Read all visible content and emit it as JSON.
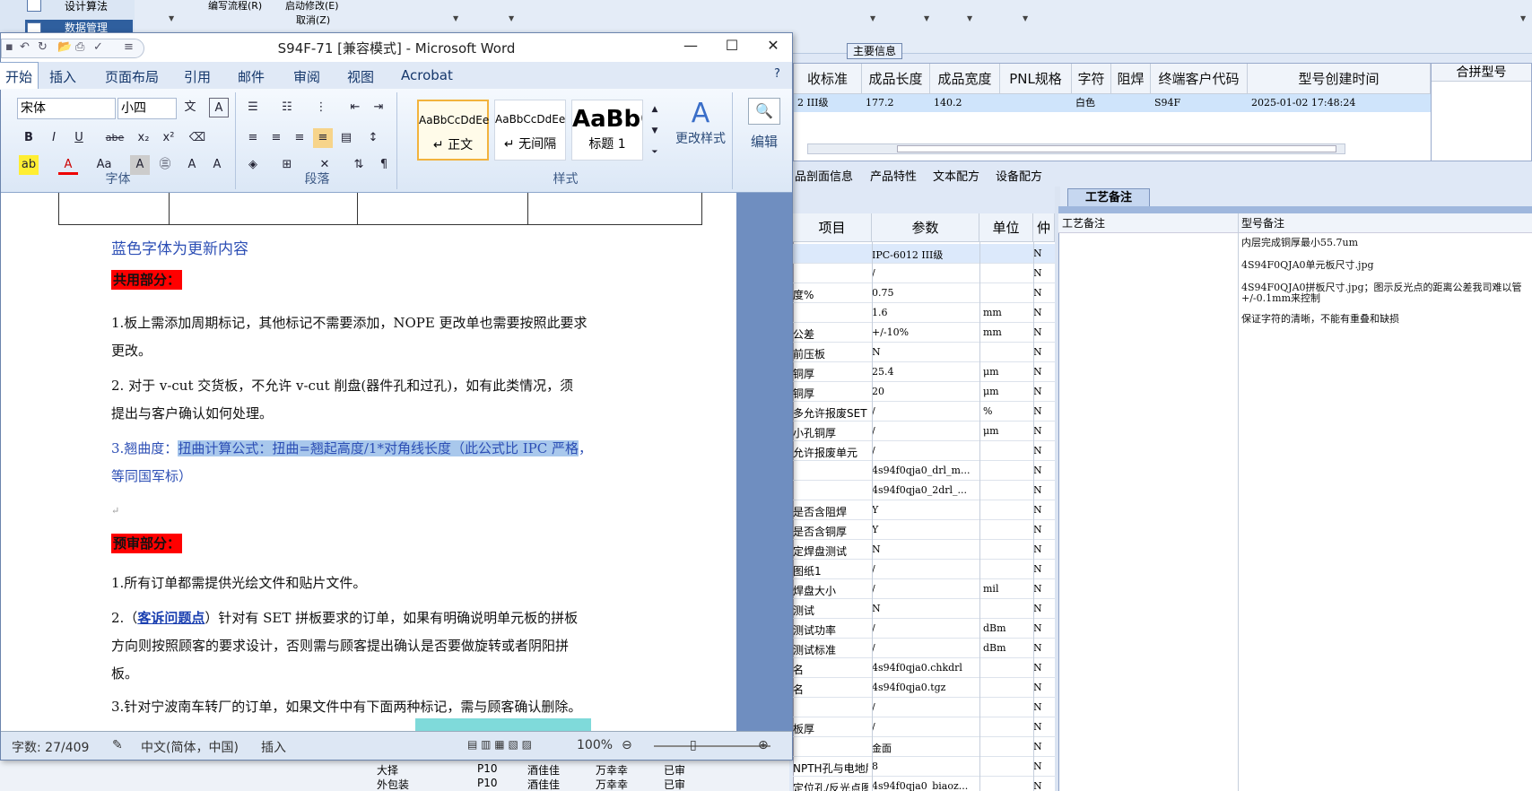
{
  "bg": {
    "left_menu": [
      "设计算法",
      "数据管理"
    ],
    "toolbar_items": [
      "编写流程(R)",
      "启动修改(E)",
      "取消(Z)"
    ],
    "info_tab": "主要信息",
    "grid_headers": [
      "收标准",
      "成品长度",
      "成品宽度",
      "PNL规格",
      "字符",
      "阻焊",
      "终端客户代码",
      "型号创建时间"
    ],
    "grid_row": [
      "2 III级",
      "177.2",
      "140.2",
      "",
      "白色",
      "",
      "S94F",
      "2025-01-02 17:48:24"
    ],
    "merge_header": "合拼型号",
    "sub_tabs": [
      "品剖面信息",
      "产品特性",
      "文本配方",
      "设备配方"
    ],
    "param_headers": [
      "项目",
      "参数",
      "单位",
      "仲"
    ],
    "param_rows": [
      [
        "",
        "IPC-6012 III级",
        "",
        "N"
      ],
      [
        "",
        "/",
        "",
        "N"
      ],
      [
        "度%",
        "0.75",
        "",
        "N"
      ],
      [
        "",
        "1.6",
        "mm",
        "N"
      ],
      [
        "公差",
        "+/-10%",
        "mm",
        "N"
      ],
      [
        "前压板",
        "N",
        "",
        "N"
      ],
      [
        "铜厚",
        "25.4",
        "μm",
        "N"
      ],
      [
        "铜厚",
        "20",
        "μm",
        "N"
      ],
      [
        "多允许报废SET",
        "/",
        "%",
        "N"
      ],
      [
        "小孔铜厚",
        "/",
        "μm",
        "N"
      ],
      [
        "允许报废单元",
        "/",
        "",
        "N"
      ],
      [
        "",
        "4s94f0qja0_drl_m...",
        "",
        "N"
      ],
      [
        "",
        "4s94f0qja0_2drl_...",
        "",
        "N"
      ],
      [
        "是否含阻焊",
        "Y",
        "",
        "N"
      ],
      [
        "是否含铜厚",
        "Y",
        "",
        "N"
      ],
      [
        "定焊盘测试",
        "N",
        "",
        "N"
      ],
      [
        "图纸1",
        "/",
        "",
        "N"
      ],
      [
        "焊盘大小",
        "/",
        "mil",
        "N"
      ],
      [
        "测试",
        "N",
        "",
        "N"
      ],
      [
        "测试功率",
        "/",
        "dBm",
        "N"
      ],
      [
        "测试标准",
        "/",
        "dBm",
        "N"
      ],
      [
        "名",
        "4s94f0qja0.chkdrl",
        "",
        "N"
      ],
      [
        "名",
        "4s94f0qja0.tgz",
        "",
        "N"
      ],
      [
        "",
        "/",
        "",
        "N"
      ],
      [
        "板厚",
        "/",
        "",
        "N"
      ],
      [
        "",
        "金面",
        "",
        "N"
      ],
      [
        "NPTH孔与电地层空距",
        "8",
        "",
        "N"
      ],
      [
        "定位孔/反光点图纸",
        "4s94f0qja0_biaoz...",
        "",
        "N"
      ]
    ],
    "remarks_tab": "工艺备注",
    "remarks_headers": [
      "工艺备注",
      "型号备注"
    ],
    "remarks_lines": [
      "内层完成铜厚最小55.7um",
      "4S94F0QJA0单元板尺寸.jpg",
      "4S94F0QJA0拼板尺寸.jpg；图示反光点的距离公差我司难以管",
      "+/-0.1mm来控制",
      "保证字符的清晰，不能有重叠和缺损"
    ],
    "bottom_list": [
      [
        "大择",
        "P10",
        "酒佳佳",
        "万幸幸",
        "已审"
      ],
      [
        "外包装",
        "P10",
        "酒佳佳",
        "万幸幸",
        "已审"
      ]
    ]
  },
  "word": {
    "title": "S94F-71 [兼容模式] - Microsoft Word",
    "tabs": [
      "开始",
      "插入",
      "页面布局",
      "引用",
      "邮件",
      "审阅",
      "视图",
      "Acrobat"
    ],
    "font_name": "宋体",
    "font_size": "小四",
    "groups": [
      "字体",
      "段落",
      "样式"
    ],
    "styles": [
      {
        "sample": "AaBbCcDdEe",
        "name": "↵ 正文"
      },
      {
        "sample": "AaBbCcDdEe",
        "name": "↵ 无间隔"
      },
      {
        "sample": "AaBbC",
        "name": "标题 1"
      }
    ],
    "change_styles": "更改样式",
    "edit": "编辑",
    "doc": {
      "heading": "蓝色字体为更新内容",
      "common": "共用部分：",
      "p1a": "1.板上需添加周期标记，其他标记不需要添加，NOPE 更改单也需要按照此要求",
      "p1b": "更改。",
      "p2a": "2. 对于 v-cut 交货板，不允许 v-cut 削盘(器件孔和过孔)，如有此类情况，须",
      "p2b": "提出与客户确认如何处理。",
      "p3pre": "3.翘曲度：",
      "p3hl": "扭曲计算公式：扭曲=翘起高度/1*对角线长度（此公式比 IPC 严格",
      "p3post": "，",
      "p3b": "等同国军标）",
      "review": "预审部分：",
      "r1": "1.所有订单都需提供光绘文件和贴片文件。",
      "r2pre": "2.（",
      "r2link": "客诉问题点",
      "r2a": "）针对有 SET 拼板要求的订单，如果有明确说明单元板的拼板",
      "r2b": "方向则按照顾客的要求设计，否则需与顾客提出确认是否要做旋转或者阴阳拼",
      "r2c": "板。",
      "r3": "3.针对宁波南车转厂的订单，如果文件中有下面两种标记，需与顾客确认删除。"
    },
    "status": {
      "words": "字数: 27/409",
      "lang": "中文(简体，中国)",
      "mode": "插入",
      "zoom": "100%"
    }
  }
}
